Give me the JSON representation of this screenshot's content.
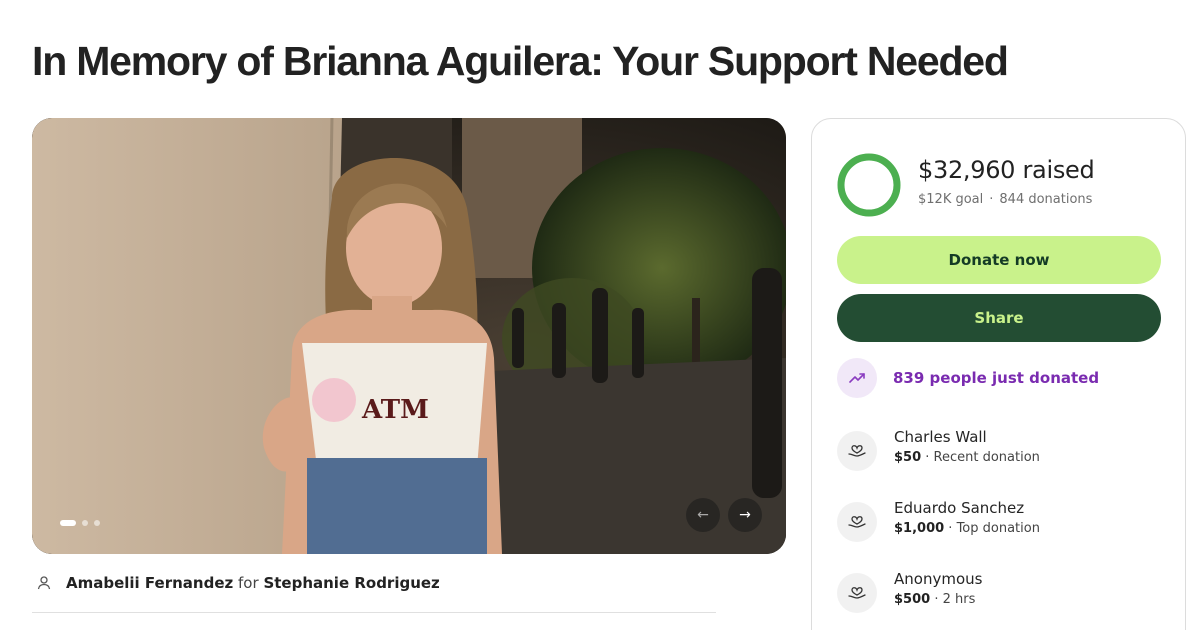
{
  "page": {
    "title": "In Memory of Brianna Aguilera: Your Support Needed"
  },
  "gallery": {
    "prev_icon": "arrow-left-icon",
    "next_icon": "arrow-right-icon",
    "prev_glyph": "←",
    "next_glyph": "→",
    "slide_count": 3,
    "active_slide": 1
  },
  "organizer": {
    "icon": "person-icon",
    "name": "Amabelii Fernandez",
    "for_text": "for",
    "beneficiary": "Stephanie Rodriguez"
  },
  "fundraiser": {
    "raised": "$32,960 raised",
    "goal": "$12K goal",
    "separator": "·",
    "donations": "844 donations",
    "progress_fraction": 1.0,
    "donate_label": "Donate now",
    "share_label": "Share",
    "trend_icon": "trending-up-icon",
    "trend_text": "839 people just donated",
    "colors": {
      "progress": "#4caf50",
      "donate_bg": "#c9f28b",
      "share_bg": "#234d33",
      "trend_text": "#7a2bb0"
    }
  },
  "donations": [
    {
      "icon": "heart-hand-icon",
      "name": "Charles Wall",
      "amount": "$50",
      "detail": " · Recent donation"
    },
    {
      "icon": "heart-hand-icon",
      "name": "Eduardo Sanchez",
      "amount": "$1,000",
      "detail": " · Top donation"
    },
    {
      "icon": "heart-hand-icon",
      "name": "Anonymous",
      "amount": "$500",
      "detail": " · 2 hrs"
    }
  ]
}
